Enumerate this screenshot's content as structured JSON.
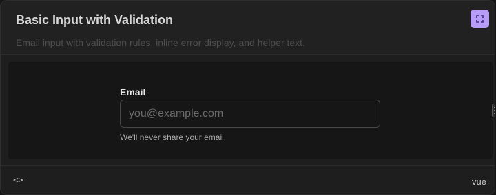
{
  "card": {
    "title": "Basic Input with Validation",
    "description": "Email input with validation rules, inline error display, and helper text.",
    "expand_icon": "expand-icon"
  },
  "preview": {
    "field_label": "Email",
    "input_value": "",
    "input_placeholder": "you@example.com",
    "helper_text": "We'll never share your email."
  },
  "footer": {
    "code_toggle": "<>",
    "framework": "vue"
  },
  "colors": {
    "accent": "#b79df7",
    "background": "#1e1e1e",
    "preview_background": "#161616"
  }
}
